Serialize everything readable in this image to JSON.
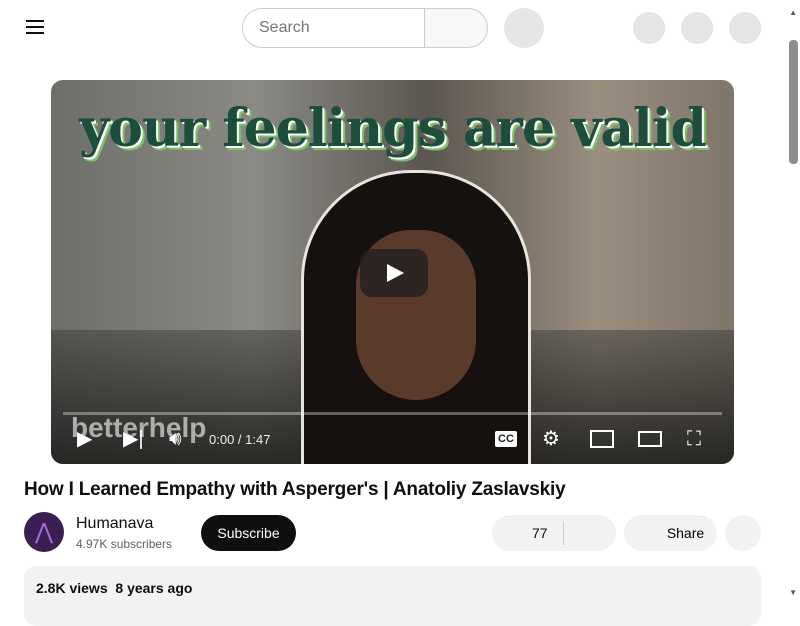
{
  "header": {
    "search_placeholder": "Search",
    "icons": [
      "menu-icon",
      "search-icon",
      "mic-icon",
      "create-icon",
      "notifications-icon",
      "avatar"
    ]
  },
  "player": {
    "thumbnail_text": "your feelings are valid",
    "watermark": "betterhelp",
    "time": "0:00 / 1:47",
    "progress": 0
  },
  "video": {
    "title": "How I Learned Empathy with Asperger's | Anatoliy Zaslavskiy",
    "channel": "Humanava",
    "subscribers": "4.97K subscribers",
    "subscribe_label": "Subscribe",
    "likes": "77",
    "share_label": "Share",
    "views": "2.8K views",
    "date": "8 years ago"
  }
}
